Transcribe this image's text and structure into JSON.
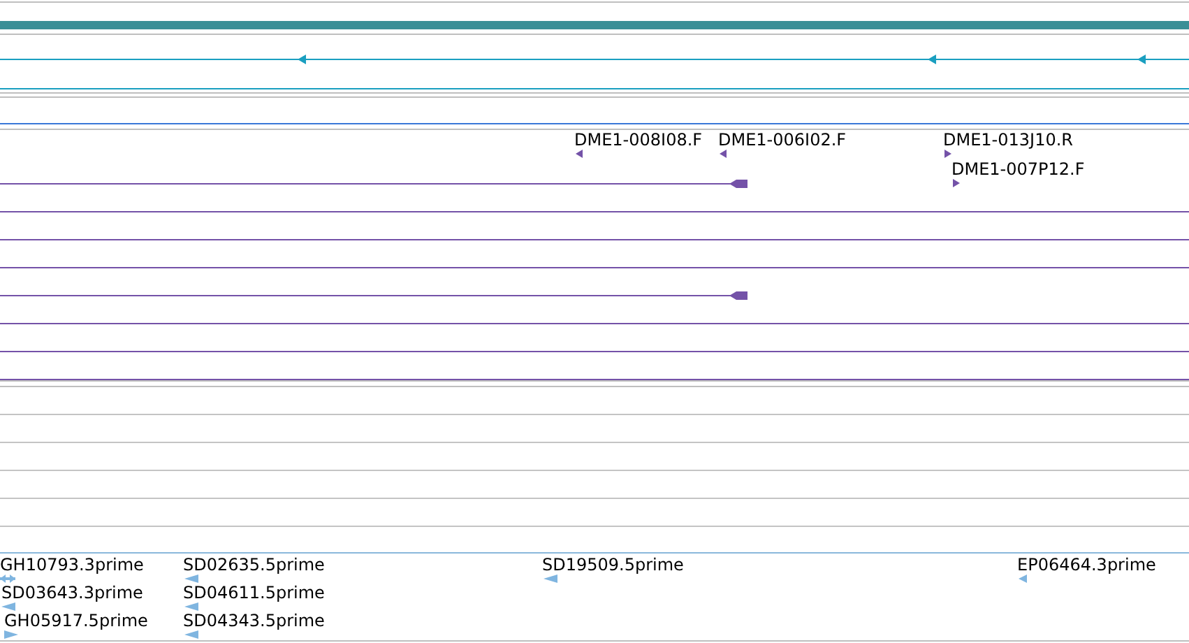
{
  "clone_track": {
    "features": [
      {
        "label": "DME1-008I08.F",
        "kind": "reverse"
      },
      {
        "label": "DME1-006I02.F",
        "kind": "reverse"
      },
      {
        "label": "DME1-013J10.R",
        "kind": "forward"
      },
      {
        "label": "DME1-007P12.F",
        "kind": "forward"
      }
    ]
  },
  "est_track": {
    "features": [
      {
        "label": "GH10793.3prime",
        "kind": "bidirectional"
      },
      {
        "label": "SD03643.3prime",
        "kind": "reverse"
      },
      {
        "label": "GH05917.5prime",
        "kind": "forward"
      },
      {
        "label": "SD02635.5prime",
        "kind": "reverse"
      },
      {
        "label": "SD04611.5prime",
        "kind": "reverse"
      },
      {
        "label": "SD04343.5prime",
        "kind": "reverse"
      },
      {
        "label": "SD19509.5prime",
        "kind": "reverse"
      },
      {
        "label": "EP06464.3prime",
        "kind": "reverse"
      }
    ]
  }
}
